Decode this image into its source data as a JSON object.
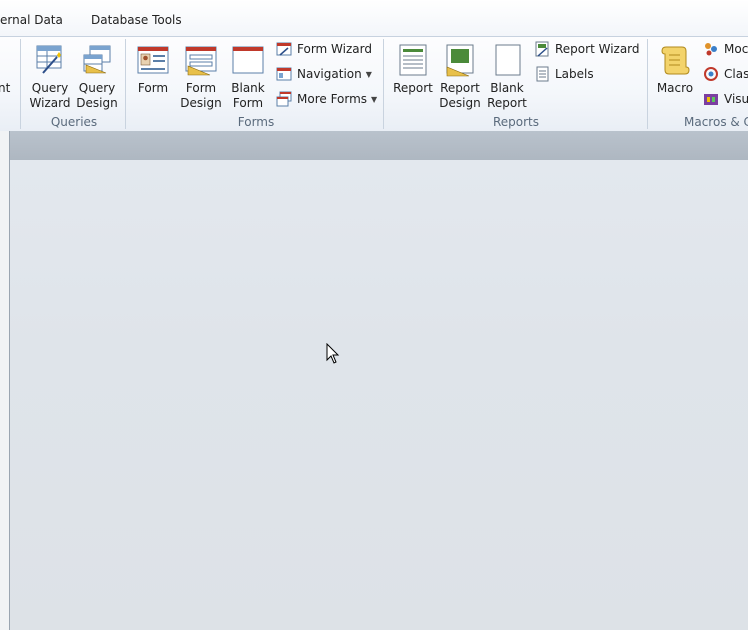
{
  "tabs": [
    "ernal Data",
    "Database Tools"
  ],
  "groups": {
    "queries": {
      "label": "Queries",
      "buttons": [
        {
          "line1": "Query",
          "line2": "Wizard",
          "icon": "query-wizard-icon"
        },
        {
          "line1": "Query",
          "line2": "Design",
          "icon": "query-design-icon"
        }
      ],
      "partial_left_label": "nt"
    },
    "forms": {
      "label": "Forms",
      "buttons": [
        {
          "line1": "Form",
          "line2": "",
          "icon": "form-icon"
        },
        {
          "line1": "Form",
          "line2": "Design",
          "icon": "form-design-icon"
        },
        {
          "line1": "Blank",
          "line2": "Form",
          "icon": "blank-form-icon"
        }
      ],
      "small": [
        "Form Wizard",
        "Navigation",
        "More Forms"
      ]
    },
    "reports": {
      "label": "Reports",
      "buttons": [
        {
          "line1": "Report",
          "line2": "",
          "icon": "report-icon"
        },
        {
          "line1": "Report",
          "line2": "Design",
          "icon": "report-design-icon"
        },
        {
          "line1": "Blank",
          "line2": "Report",
          "icon": "blank-report-icon"
        }
      ],
      "small": [
        "Report Wizard",
        "Labels"
      ]
    },
    "macros": {
      "label": "Macros & C",
      "macro_label": "Macro",
      "small": [
        "Moc",
        "Clas",
        "Visu"
      ]
    }
  },
  "colors": {
    "accent": "#3a6ea5",
    "workspace": "#dfe3e8"
  }
}
